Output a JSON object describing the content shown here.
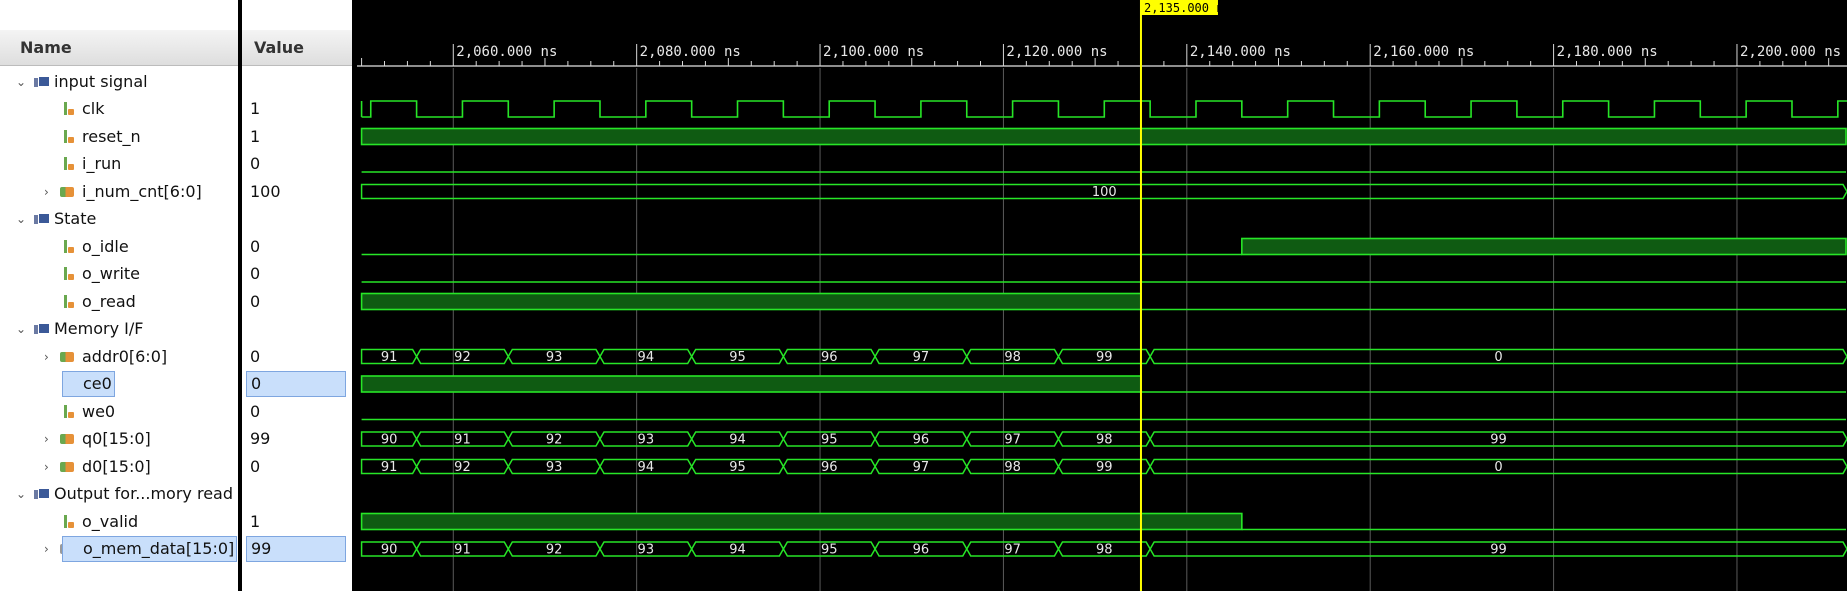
{
  "columns": {
    "name": "Name",
    "value": "Value"
  },
  "cursor": {
    "label": "2,135.000 ns",
    "time": 2135
  },
  "timeline": {
    "start": 2049.5,
    "end": 2212,
    "ticks": [
      {
        "t": 2060,
        "label": "2,060.000 ns"
      },
      {
        "t": 2080,
        "label": "2,080.000 ns"
      },
      {
        "t": 2100,
        "label": "2,100.000 ns"
      },
      {
        "t": 2120,
        "label": "2,120.000 ns"
      },
      {
        "t": 2140,
        "label": "2,140.000 ns"
      },
      {
        "t": 2160,
        "label": "2,160.000 ns"
      },
      {
        "t": 2180,
        "label": "2,180.000 ns"
      },
      {
        "t": 2200,
        "label": "2,200.000 ns"
      }
    ]
  },
  "rows": [
    {
      "kind": "group",
      "name": "input signal"
    },
    {
      "kind": "bit",
      "name": "clk",
      "value": "1",
      "wave": {
        "type": "clock",
        "period": 10,
        "high_start": 2056
      }
    },
    {
      "kind": "bit",
      "name": "reset_n",
      "value": "1",
      "wave": {
        "type": "level",
        "segments": [
          {
            "from": 2050,
            "to": 2212,
            "v": 1
          }
        ]
      }
    },
    {
      "kind": "bit",
      "name": "i_run",
      "value": "0",
      "wave": {
        "type": "level",
        "segments": [
          {
            "from": 2050,
            "to": 2212,
            "v": 0
          }
        ]
      }
    },
    {
      "kind": "bus",
      "name": "i_num_cnt[6:0]",
      "value": "100",
      "wave": {
        "type": "bus",
        "segments": [
          {
            "from": 2050,
            "to": 2212,
            "label": "100"
          }
        ]
      }
    },
    {
      "kind": "group",
      "name": "State"
    },
    {
      "kind": "bit",
      "name": "o_idle",
      "value": "0",
      "wave": {
        "type": "level",
        "segments": [
          {
            "from": 2050,
            "to": 2146,
            "v": 0
          },
          {
            "from": 2146,
            "to": 2212,
            "v": 1
          }
        ]
      }
    },
    {
      "kind": "bit",
      "name": "o_write",
      "value": "0",
      "wave": {
        "type": "level",
        "segments": [
          {
            "from": 2050,
            "to": 2212,
            "v": 0
          }
        ]
      }
    },
    {
      "kind": "bit",
      "name": "o_read",
      "value": "0",
      "wave": {
        "type": "level",
        "segments": [
          {
            "from": 2050,
            "to": 2135,
            "v": 1
          },
          {
            "from": 2135,
            "to": 2212,
            "v": 0
          }
        ]
      }
    },
    {
      "kind": "group",
      "name": "Memory I/F"
    },
    {
      "kind": "bus",
      "name": "addr0[6:0]",
      "value": "0",
      "wave": {
        "type": "bus",
        "segments": [
          {
            "from": 2050,
            "to": 2056,
            "label": "91"
          },
          {
            "from": 2056,
            "to": 2066,
            "label": "92"
          },
          {
            "from": 2066,
            "to": 2076,
            "label": "93"
          },
          {
            "from": 2076,
            "to": 2086,
            "label": "94"
          },
          {
            "from": 2086,
            "to": 2096,
            "label": "95"
          },
          {
            "from": 2096,
            "to": 2106,
            "label": "96"
          },
          {
            "from": 2106,
            "to": 2116,
            "label": "97"
          },
          {
            "from": 2116,
            "to": 2126,
            "label": "98"
          },
          {
            "from": 2126,
            "to": 2136,
            "label": "99"
          },
          {
            "from": 2136,
            "to": 2212,
            "label": "0"
          }
        ]
      }
    },
    {
      "kind": "bit",
      "name": "ce0",
      "value": "0",
      "selected": true,
      "wave": {
        "type": "level",
        "segments": [
          {
            "from": 2050,
            "to": 2135,
            "v": 1
          },
          {
            "from": 2135,
            "to": 2212,
            "v": 0
          }
        ]
      }
    },
    {
      "kind": "bit",
      "name": "we0",
      "value": "0",
      "wave": {
        "type": "level",
        "segments": [
          {
            "from": 2050,
            "to": 2212,
            "v": 0
          }
        ]
      }
    },
    {
      "kind": "bus",
      "name": "q0[15:0]",
      "value": "99",
      "wave": {
        "type": "bus",
        "segments": [
          {
            "from": 2050,
            "to": 2056,
            "label": "90"
          },
          {
            "from": 2056,
            "to": 2066,
            "label": "91"
          },
          {
            "from": 2066,
            "to": 2076,
            "label": "92"
          },
          {
            "from": 2076,
            "to": 2086,
            "label": "93"
          },
          {
            "from": 2086,
            "to": 2096,
            "label": "94"
          },
          {
            "from": 2096,
            "to": 2106,
            "label": "95"
          },
          {
            "from": 2106,
            "to": 2116,
            "label": "96"
          },
          {
            "from": 2116,
            "to": 2126,
            "label": "97"
          },
          {
            "from": 2126,
            "to": 2136,
            "label": "98"
          },
          {
            "from": 2136,
            "to": 2212,
            "label": "99"
          }
        ]
      }
    },
    {
      "kind": "bus",
      "name": "d0[15:0]",
      "value": "0",
      "wave": {
        "type": "bus",
        "segments": [
          {
            "from": 2050,
            "to": 2056,
            "label": "91"
          },
          {
            "from": 2056,
            "to": 2066,
            "label": "92"
          },
          {
            "from": 2066,
            "to": 2076,
            "label": "93"
          },
          {
            "from": 2076,
            "to": 2086,
            "label": "94"
          },
          {
            "from": 2086,
            "to": 2096,
            "label": "95"
          },
          {
            "from": 2096,
            "to": 2106,
            "label": "96"
          },
          {
            "from": 2106,
            "to": 2116,
            "label": "97"
          },
          {
            "from": 2116,
            "to": 2126,
            "label": "98"
          },
          {
            "from": 2126,
            "to": 2136,
            "label": "99"
          },
          {
            "from": 2136,
            "to": 2212,
            "label": "0"
          }
        ]
      }
    },
    {
      "kind": "group",
      "name": "Output for...mory read"
    },
    {
      "kind": "bit",
      "name": "o_valid",
      "value": "1",
      "wave": {
        "type": "level",
        "segments": [
          {
            "from": 2050,
            "to": 2146,
            "v": 1
          },
          {
            "from": 2146,
            "to": 2212,
            "v": 0
          }
        ]
      }
    },
    {
      "kind": "bus",
      "name": "o_mem_data[15:0]",
      "value": "99",
      "selected": true,
      "dim": true,
      "wave": {
        "type": "bus",
        "segments": [
          {
            "from": 2050,
            "to": 2056,
            "label": "90"
          },
          {
            "from": 2056,
            "to": 2066,
            "label": "91"
          },
          {
            "from": 2066,
            "to": 2076,
            "label": "92"
          },
          {
            "from": 2076,
            "to": 2086,
            "label": "93"
          },
          {
            "from": 2086,
            "to": 2096,
            "label": "94"
          },
          {
            "from": 2096,
            "to": 2106,
            "label": "95"
          },
          {
            "from": 2106,
            "to": 2116,
            "label": "96"
          },
          {
            "from": 2116,
            "to": 2126,
            "label": "97"
          },
          {
            "from": 2126,
            "to": 2136,
            "label": "98"
          },
          {
            "from": 2136,
            "to": 2212,
            "label": "99"
          }
        ]
      }
    }
  ],
  "colors": {
    "signal": "#27e627",
    "signal_fill": "#0f5b12",
    "cursor": "#ffff00",
    "grid": "#5a5a5a",
    "selection": "#c9dffb"
  }
}
